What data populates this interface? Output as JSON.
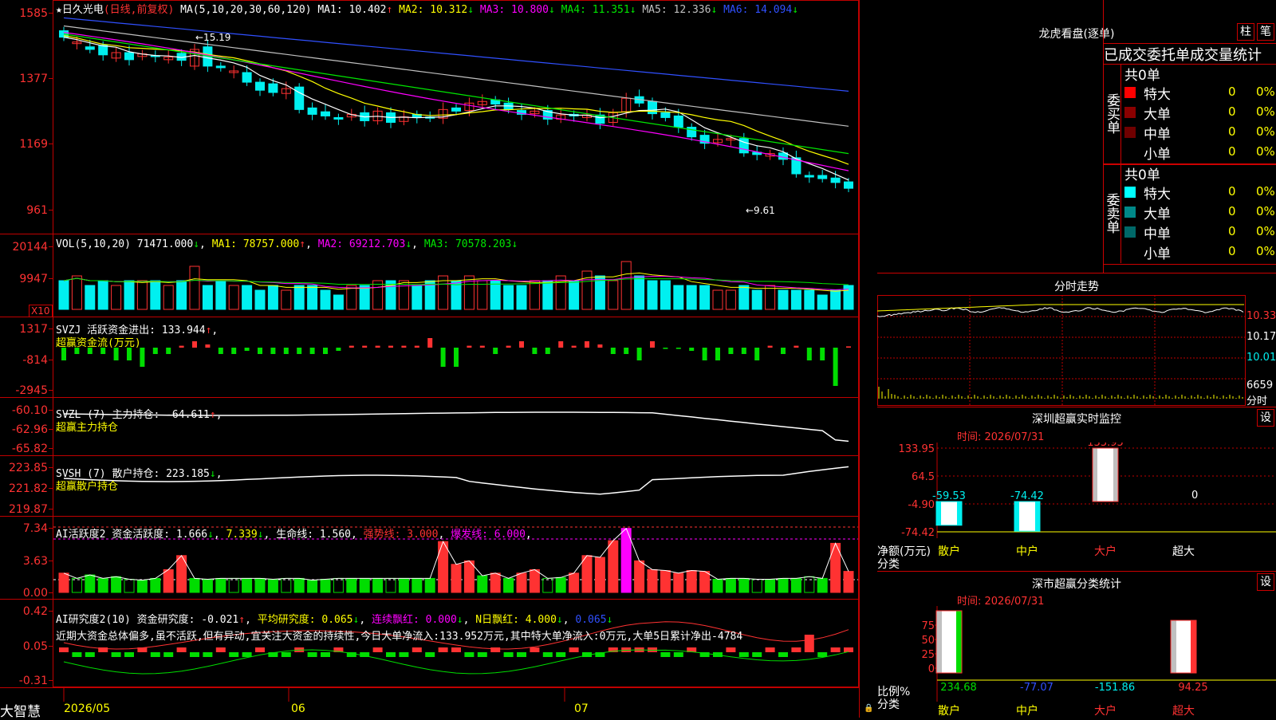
{
  "colors": {
    "up": "#ff3232",
    "down": "#00f0f0",
    "frame": "#c00000",
    "ma1": "#ffffff",
    "ma2": "#ffff00",
    "ma3": "#ff00ff",
    "ma4": "#00e600",
    "ma5": "#c0c0c0",
    "ma6": "#3050ff",
    "green_bar": "#00dd00"
  },
  "main": {
    "star_icon": "★",
    "stock_name": "日久光电",
    "period": "(日线,前复权)",
    "ma_params": "MA(5,10,20,30,60,120)",
    "ma1": "MA1: 10.402",
    "ma2": "MA2: 10.312",
    "ma3": "MA3: 10.800",
    "ma4": "MA4: 11.351",
    "ma5": "MA5: 12.336",
    "ma6": "MA6: 14.094",
    "arrows": {
      "ma1": "↑",
      "ma2": "↓",
      "ma3": "↓",
      "ma4": "↓",
      "ma5": "↓",
      "ma6": "↓"
    },
    "y_ticks": [
      "1585",
      "1377",
      "1169",
      "961"
    ],
    "high_label": "←15.19",
    "low_label": "←9.61"
  },
  "vol": {
    "title": "VOL(5,10,20)",
    "value": "71471.000",
    "ma1": "MA1: 78757.000",
    "ma2": "MA2: 69212.703",
    "ma3": "MA3: 70578.203",
    "arrows": {
      "value": "↓",
      "ma1": "↑",
      "ma2": "↓",
      "ma3": "↓"
    },
    "y_ticks": [
      "20144",
      "9947"
    ],
    "unit": "X10"
  },
  "svzj": {
    "title": "SVZJ  活跃资金进出: 133.944",
    "arrow": "↑",
    "sub": "超赢资金流(万元)",
    "y_ticks": [
      "1317",
      "-814",
      "-2945"
    ]
  },
  "svzl": {
    "title": "SVZL (7) 主力持仓: -64.611",
    "arrow": "↑",
    "sub": "超赢主力持仓",
    "y_ticks": [
      "-60.10",
      "-62.96",
      "-65.82"
    ]
  },
  "svsh": {
    "title": "SVSH (7) 散户持仓: 223.185",
    "arrow": "↓",
    "sub": "超赢散户持仓",
    "y_ticks": [
      "223.85",
      "221.82",
      "219.87"
    ]
  },
  "ai_active": {
    "title": "AI活跃度2 资金活跃度: 1.666",
    "v2": "7.339",
    "life": "生命线: 1.560",
    "strong": "强势线: 3.000",
    "burst": "爆发线: 6.000",
    "arrows": {
      "a": "↓",
      "b": "↓"
    },
    "y_ticks": [
      "7.34",
      "3.63",
      "0.00"
    ]
  },
  "ai_research": {
    "title": "AI研究度2(10) 资金研究度: -0.021",
    "avg": "平均研究度: 0.065",
    "streak": "连续飘红: 0.000",
    "nday": "N日飘红: 4.000",
    "last": "0.065",
    "arrows": {
      "a": "↑",
      "b": "↓",
      "c": "↓",
      "d": "↓",
      "e": "↓"
    },
    "comment": "近期大资金总体偏多,虽不活跃,但有异动,宜关注大资金的持续性,今日大单净流入:133.952万元,其中特大单净流入:0万元,大单5日累计净出-4784",
    "y_ticks": [
      "0.42",
      "0.05",
      "-0.31"
    ]
  },
  "xaxis": {
    "brand": "大智慧",
    "labels": [
      "2026/05",
      "06",
      "07"
    ],
    "lock_icon": "🔒"
  },
  "dragon": {
    "title": "龙虎看盘(逐单)",
    "btn1": "柱",
    "btn2": "笔",
    "tabs": "已成交委托单成交量统计",
    "buy_group": "委买单",
    "sell_group": "委卖单",
    "buy_total": "共0单",
    "sell_total": "共0单",
    "buy_rows": [
      {
        "label": "特大",
        "count": "0",
        "pct": "0%",
        "color": "#ff0000"
      },
      {
        "label": "大单",
        "count": "0",
        "pct": "0%",
        "color": "#8b0000"
      },
      {
        "label": "中单",
        "count": "0",
        "pct": "0%",
        "color": "#700000"
      },
      {
        "label": "小单",
        "count": "0",
        "pct": "0%",
        "color": ""
      }
    ],
    "sell_rows": [
      {
        "label": "特大",
        "count": "0",
        "pct": "0%",
        "color": "#00ffff"
      },
      {
        "label": "大单",
        "count": "0",
        "pct": "0%",
        "color": "#008888"
      },
      {
        "label": "中单",
        "count": "0",
        "pct": "0%",
        "color": "#006868"
      },
      {
        "label": "小单",
        "count": "0",
        "pct": "0%",
        "color": ""
      }
    ]
  },
  "fenshi": {
    "title": "分时走势",
    "y1": "10.33",
    "y2": "10.17",
    "y3": "10.01",
    "vol": "6659",
    "unit": "分时"
  },
  "sz_monitor": {
    "title": "深圳超赢实时监控",
    "btn": "设",
    "time": "时间: 2026/07/31",
    "y_ticks": [
      "133.95",
      "64.5",
      "-4.90",
      "-74.42"
    ],
    "net_label": "净额(万元)",
    "cat_label": "分类",
    "cats": [
      "散户",
      "中户",
      "大户",
      "超大"
    ],
    "values": [
      -59.53,
      -74.42,
      133.95,
      0
    ],
    "value_labels": [
      "-59.53",
      "-74.42",
      "133.95",
      "0"
    ]
  },
  "sz_class": {
    "title": "深市超赢分类统计",
    "btn": "设",
    "time": "时间: 2026/07/31",
    "y_ticks": [
      "75",
      "50",
      "25",
      "0"
    ],
    "ratio_label": "比例%",
    "cat_label": "分类",
    "cats": [
      "散户",
      "中户",
      "大户",
      "超大"
    ],
    "value_labels": [
      "234.68",
      "-77.07",
      "-151.86",
      "94.25"
    ],
    "values": [
      234.68,
      -77.07,
      -151.86,
      94.25
    ]
  }
}
